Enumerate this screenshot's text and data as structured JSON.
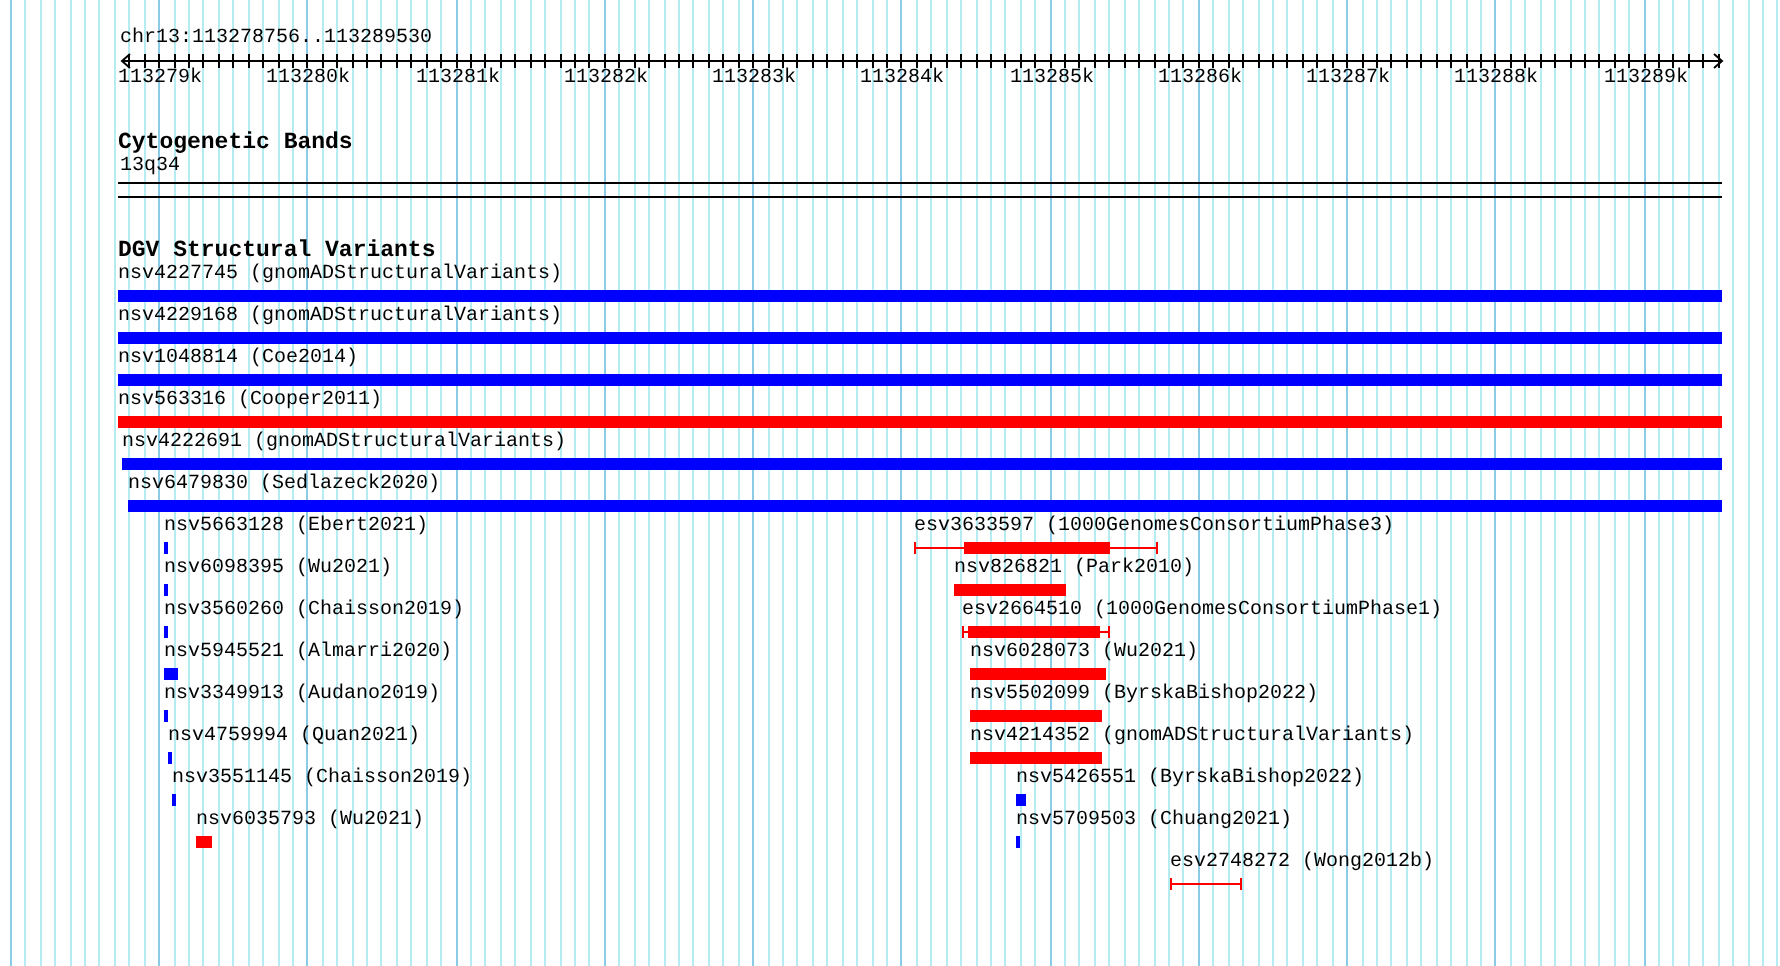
{
  "location": "chr13:113278756..113289530",
  "ruler": {
    "labels": [
      "113279k",
      "113280k",
      "113281k",
      "113282k",
      "113283k",
      "113284k",
      "113285k",
      "113286k",
      "113287k",
      "113288k",
      "113289k"
    ]
  },
  "cytogenetic_bands": {
    "title": "Cytogenetic Bands",
    "band": "13q34"
  },
  "dgv_track": {
    "title": "DGV Structural Variants",
    "rows": [
      [
        {
          "kind": "bar",
          "name": "nsv4227745 (gnomADStructuralVariants)",
          "color": "#0000ff"
        }
      ],
      [
        {
          "kind": "bar",
          "name": "nsv4229168 (gnomADStructuralVariants)",
          "color": "#0000ff"
        }
      ],
      [
        {
          "kind": "bar",
          "name": "nsv1048814 (Coe2014)",
          "color": "#0000ff"
        }
      ],
      [
        {
          "kind": "bar",
          "name": "nsv563316 (Cooper2011)",
          "color": "#ff0000"
        }
      ],
      [
        {
          "kind": "bar",
          "name": "nsv4222691 (gnomADStructuralVariants)",
          "color": "#0000ff"
        }
      ],
      [
        {
          "kind": "bar",
          "name": "nsv6479830 (Sedlazeck2020)",
          "color": "#0000ff"
        }
      ],
      [
        {
          "kind": "bar",
          "name": "nsv5663128 (Ebert2021)",
          "color": "#0000ff"
        },
        {
          "kind": "span",
          "name": "esv3633597 (1000GenomesConsortiumPhase3)",
          "color": "#ff0000"
        }
      ],
      [
        {
          "kind": "bar",
          "name": "nsv6098395 (Wu2021)",
          "color": "#0000ff"
        },
        {
          "kind": "bar",
          "name": "nsv826821 (Park2010)",
          "color": "#ff0000"
        }
      ],
      [
        {
          "kind": "bar",
          "name": "nsv3560260 (Chaisson2019)",
          "color": "#0000ff"
        },
        {
          "kind": "span",
          "name": "esv2664510 (1000GenomesConsortiumPhase1)",
          "color": "#ff0000"
        }
      ],
      [
        {
          "kind": "bar",
          "name": "nsv5945521 (Almarri2020)",
          "color": "#0000ff"
        },
        {
          "kind": "bar",
          "name": "nsv6028073 (Wu2021)",
          "color": "#ff0000"
        }
      ],
      [
        {
          "kind": "bar",
          "name": "nsv3349913 (Audano2019)",
          "color": "#0000ff"
        },
        {
          "kind": "bar",
          "name": "nsv5502099 (ByrskaBishop2022)",
          "color": "#ff0000"
        }
      ],
      [
        {
          "kind": "bar",
          "name": "nsv4759994 (Quan2021)",
          "color": "#0000ff"
        },
        {
          "kind": "bar",
          "name": "nsv4214352 (gnomADStructuralVariants)",
          "color": "#ff0000"
        }
      ],
      [
        {
          "kind": "bar",
          "name": "nsv3551145 (Chaisson2019)",
          "color": "#0000ff"
        },
        {
          "kind": "bar",
          "name": "nsv5426551 (ByrskaBishop2022)",
          "color": "#0000ff"
        }
      ],
      [
        {
          "kind": "bar",
          "name": "nsv6035793 (Wu2021)",
          "color": "#ff0000"
        },
        {
          "kind": "bar",
          "name": "nsv5709503 (Chuang2021)",
          "color": "#0000ff"
        }
      ],
      [
        {
          "kind": "span",
          "name": "esv2748272 (Wong2012b)",
          "color": "#ff0000"
        }
      ]
    ]
  }
}
